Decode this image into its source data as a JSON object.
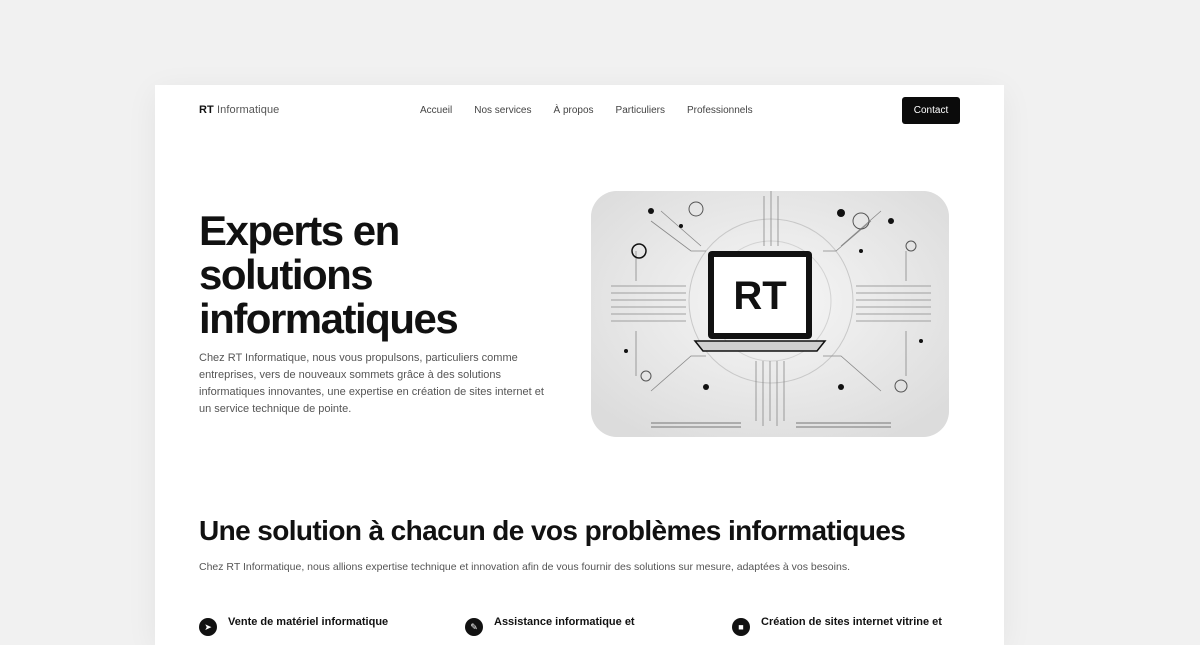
{
  "nav": {
    "logo_bold": "RT",
    "logo_light": "Informatique",
    "items": [
      "Accueil",
      "Nos services",
      "À propos",
      "Particuliers",
      "Professionnels"
    ],
    "cta": "Contact"
  },
  "hero": {
    "title_lines": [
      "Experts en",
      "solutions",
      "informatiques"
    ],
    "text": "Chez RT Informatique, nous vous propulsons, particuliers comme entreprises, vers de nouveaux sommets grâce à des solutions informatiques innovantes, une expertise en création de sites internet et un service technique de pointe.",
    "image_label": "RT"
  },
  "section": {
    "title": "Une solution à chacun de vos problèmes informatiques",
    "text": "Chez RT Informatique, nous allions expertise technique et innovation afin de vous fournir des solutions sur mesure, adaptées à vos besoins."
  },
  "features": [
    {
      "label": "Vente de matériel informatique",
      "icon": "cart-icon"
    },
    {
      "label": "Assistance informatique et",
      "icon": "wrench-icon"
    },
    {
      "label": "Création de sites internet vitrine et",
      "icon": "monitor-icon"
    }
  ],
  "colors": {
    "accent": "#0b0b0b",
    "page_bg": "#f1f1f1",
    "card_bg": "#ffffff"
  }
}
